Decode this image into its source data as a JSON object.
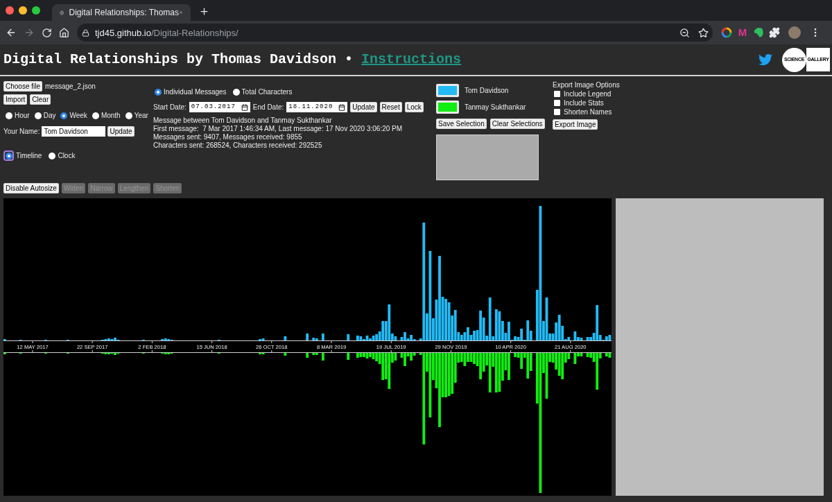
{
  "browser": {
    "tab": {
      "title": "Digital Relationships: Thomas"
    },
    "address": {
      "host": "tjd45.github.io",
      "path": "/Digital-Relationships/"
    },
    "extension_letter": "M"
  },
  "header": {
    "title": "Digital Relationships by Thomas Davidson •",
    "link": "Instructions",
    "logo": [
      "SCIENCE",
      "GALLERY"
    ]
  },
  "file": {
    "button": "Choose file",
    "file_name": "message_2.json",
    "buttons": [
      "Import",
      "Clear"
    ]
  },
  "granularity": [
    {
      "label": "Hour",
      "selected": false
    },
    {
      "label": "Day",
      "selected": false
    },
    {
      "label": "Week",
      "selected": true
    },
    {
      "label": "Month",
      "selected": false
    },
    {
      "label": "Year",
      "selected": false
    }
  ],
  "name_field": {
    "label": "Your Name:",
    "value": "Tom Davidson",
    "button": "Update"
  },
  "view_mode": [
    {
      "label": "Timeline",
      "selected": true,
      "focused": true
    },
    {
      "label": "Clock",
      "selected": false,
      "focused": false
    }
  ],
  "measure": [
    {
      "label": "Individual Messages",
      "selected": true
    },
    {
      "label": "Total Characters",
      "selected": false
    }
  ],
  "dates": {
    "start_label": "Start Date:",
    "start": "07.03.2017",
    "end_label": "End Date:",
    "end": "18.11.2020",
    "buttons": [
      "Update",
      "Reset",
      "Lock"
    ]
  },
  "stats": [
    "Message between Tom Davidson and Tanmay Sukthankar",
    "First message:  7 Mar 2017 1:46:34 AM, Last message: 17 Nov 2020 3:06:20 PM",
    "Messages sent: 9407, Messages received: 9855",
    "Characters sent: 268524, Characters received: 292525"
  ],
  "legend": [
    {
      "name": "Tom Davidson",
      "color": "#22bbf7"
    },
    {
      "name": "Tanmay Sukthankar",
      "color": "#11ee11"
    }
  ],
  "selection_buttons": [
    "Save Selection",
    "Clear Selections"
  ],
  "export": {
    "title": "Export Image Options",
    "options": [
      {
        "label": "Include Legend",
        "checked": false
      },
      {
        "label": "Include Stats",
        "checked": false
      },
      {
        "label": "Shorten Names",
        "checked": false
      }
    ],
    "button": "Export Image"
  },
  "size_buttons": [
    {
      "label": "Disable Autosize",
      "disabled": false
    },
    {
      "label": "Widen",
      "disabled": true
    },
    {
      "label": "Narrow",
      "disabled": true
    },
    {
      "label": "Lengthen",
      "disabled": true
    },
    {
      "label": "Shorten",
      "disabled": true
    }
  ],
  "timeline": {
    "axis_labels": [
      "12 MAY 2017",
      "22 SEP 2017",
      "2 FEB 2018",
      "15 JUN 2018",
      "26 OCT 2018",
      "8 MAR 2019",
      "19 JUL 2019",
      "29 NOV 2019",
      "10 APR 2020",
      "21 AUG 2020"
    ]
  }
}
